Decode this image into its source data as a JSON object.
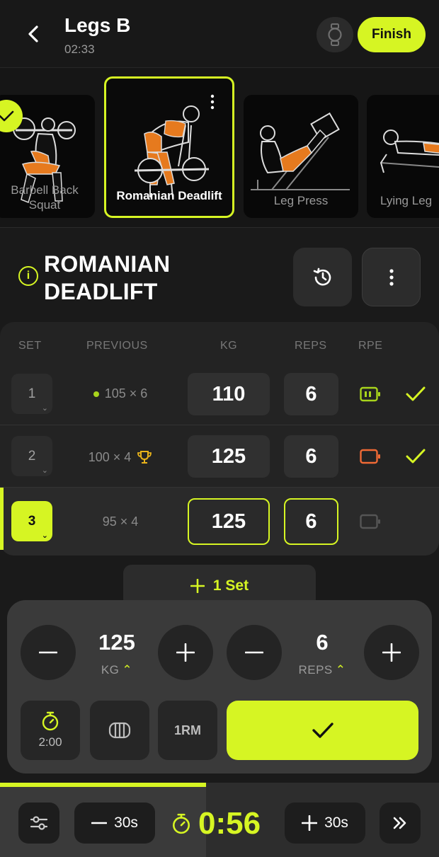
{
  "header": {
    "title": "Legs B",
    "elapsed": "02:33",
    "finish_label": "Finish"
  },
  "carousel": {
    "items": [
      {
        "label_line1": "Barbell Back",
        "label_line2": "Squat",
        "done": true
      },
      {
        "label_line1": "Romanian Deadlift",
        "label_line2": "",
        "active": true
      },
      {
        "label_line1": "Leg Press",
        "label_line2": ""
      },
      {
        "label_line1": "Lying Leg",
        "label_line2": ""
      }
    ]
  },
  "exercise": {
    "title_line1": "ROMANIAN",
    "title_line2": "DEADLIFT"
  },
  "table": {
    "headers": {
      "set": "SET",
      "previous": "PREVIOUS",
      "kg": "KG",
      "reps": "REPS",
      "rpe": "RPE"
    },
    "rows": [
      {
        "set": "1",
        "previous": "105 × 6",
        "kg": "110",
        "reps": "6",
        "rpe_color": "#a8d41c",
        "done": true,
        "prev_marker": "dot"
      },
      {
        "set": "2",
        "previous": "100 × 4",
        "kg": "125",
        "reps": "6",
        "rpe_color": "#f06a35",
        "done": true,
        "prev_marker": "trophy"
      },
      {
        "set": "3",
        "previous": "95 × 4",
        "kg": "125",
        "reps": "6",
        "rpe_color": "#555555",
        "done": false,
        "current": true
      }
    ]
  },
  "add_set_label": "1 Set",
  "keypad": {
    "kg_value": "125",
    "kg_unit": "KG",
    "reps_value": "6",
    "reps_unit": "REPS",
    "timer_label": "2:00",
    "one_rm_label": "1RM"
  },
  "rest_bar": {
    "minus_label": "30s",
    "plus_label": "30s",
    "remaining": "0:56",
    "progress_fraction": 0.47
  },
  "colors": {
    "accent": "#d6f523",
    "bg": "#1a1a1a"
  }
}
